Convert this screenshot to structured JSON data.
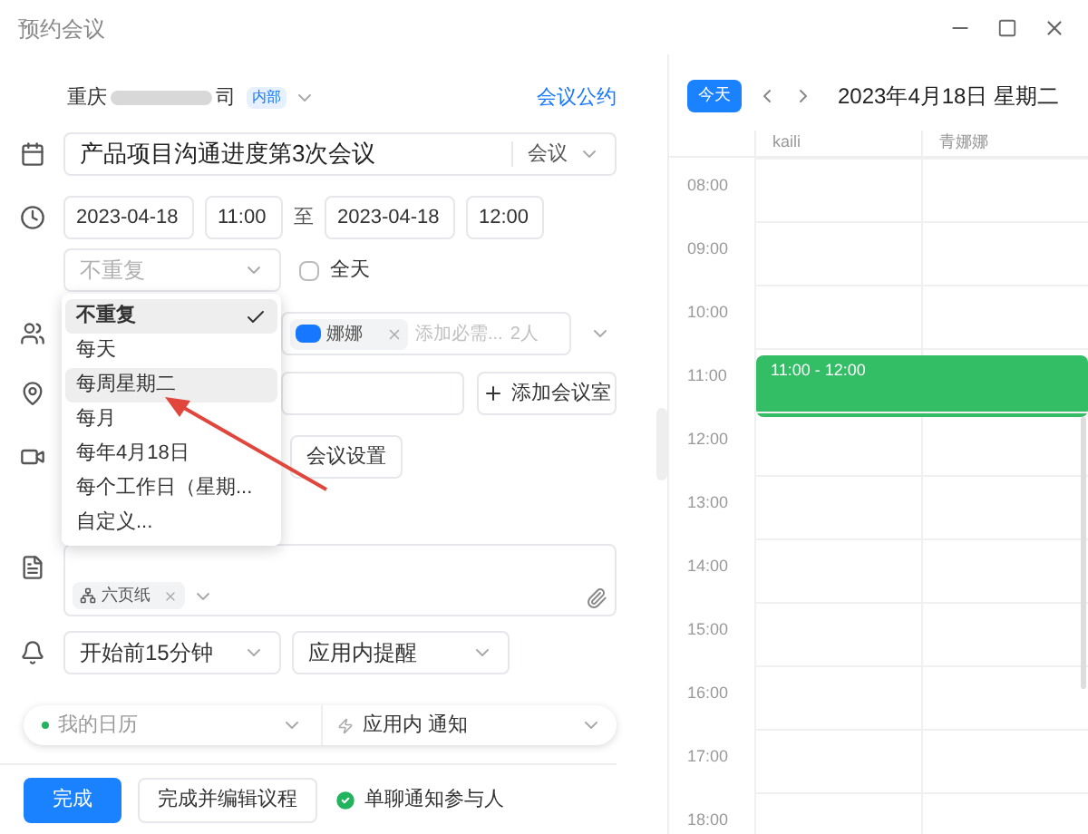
{
  "window": {
    "title": "预约会议"
  },
  "organizer": {
    "name_start": "重庆",
    "name_end": "司",
    "badge": "内部",
    "link": "会议公约"
  },
  "title_field": {
    "value": "产品项目沟通进度第3次会议",
    "type": "会议"
  },
  "time": {
    "start_date": "2023-04-18",
    "start_time": "11:00",
    "separator": "至",
    "end_date": "2023-04-18",
    "end_time": "12:00"
  },
  "repeat": {
    "placeholder": "不重复",
    "all_day": {
      "label": "全天",
      "checked": false
    }
  },
  "repeat_menu": [
    {
      "label": "不重复",
      "selected": true,
      "hovered": false
    },
    {
      "label": "每天",
      "selected": false,
      "hovered": false
    },
    {
      "label": "每周星期二",
      "selected": false,
      "hovered": true
    },
    {
      "label": "每月",
      "selected": false,
      "hovered": false
    },
    {
      "label": "每年4月18日",
      "selected": false,
      "hovered": false
    },
    {
      "label": "每个工作日（星期...",
      "selected": false,
      "hovered": false
    },
    {
      "label": "自定义...",
      "selected": false,
      "hovered": false
    }
  ],
  "participants": {
    "chips": [
      "娜娜"
    ],
    "placeholder": "添加必需...",
    "count": "2人"
  },
  "location": {
    "add_room": "添加会议室"
  },
  "video": {
    "settings": "会议设置"
  },
  "notes": {
    "attachments": [
      "六页纸"
    ]
  },
  "reminder": {
    "time": "开始前15分钟",
    "method": "应用内提醒"
  },
  "calendar_select": {
    "calendar": "我的日历",
    "notify": "应用内 通知"
  },
  "footer": {
    "done": "完成",
    "done_edit": "完成并编辑议程",
    "notify_participants": {
      "label": "单聊通知参与人",
      "checked": true
    }
  },
  "calendar": {
    "today": "今天",
    "date": "2023年4月18日 星期二",
    "columns": [
      "kaili",
      "青娜娜"
    ],
    "hours": [
      {
        "label": "08:00"
      },
      {
        "label": "09:00"
      },
      {
        "label": "10:00"
      },
      {
        "label": "11:00",
        "event": "11:00 - 12:00"
      },
      {
        "label": "12:00"
      },
      {
        "label": "13:00"
      },
      {
        "label": "14:00"
      },
      {
        "label": "15:00"
      },
      {
        "label": "16:00"
      },
      {
        "label": "17:00"
      },
      {
        "label": "18:00"
      }
    ]
  }
}
